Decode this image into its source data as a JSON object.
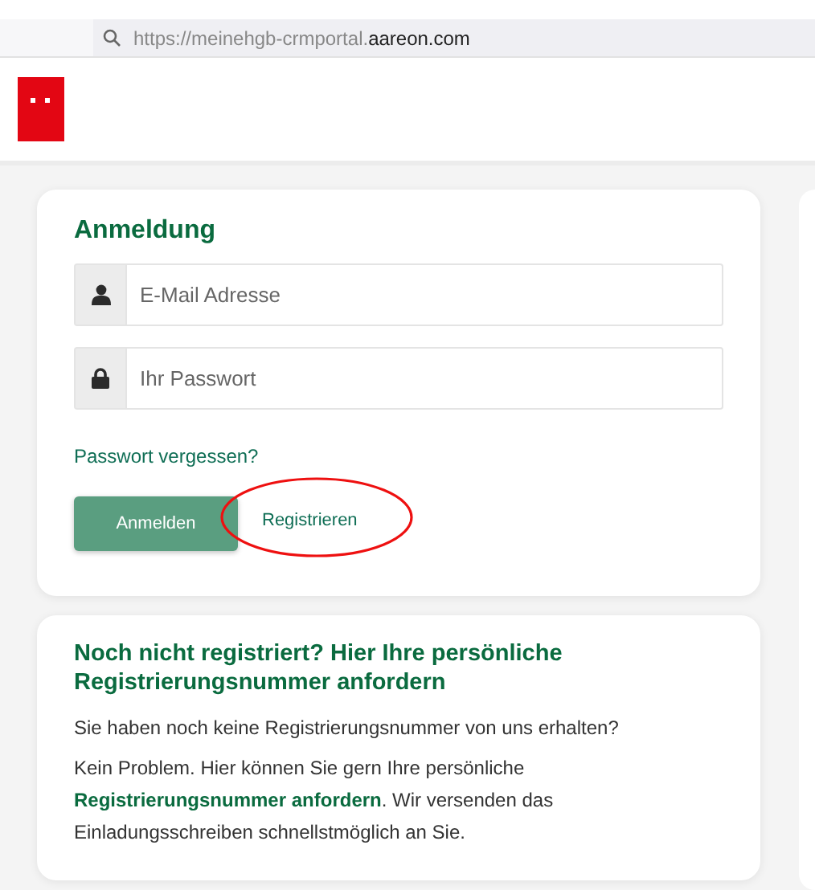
{
  "browser": {
    "url_prefix": "https://meinehgb-crmportal.",
    "url_domain": "aareon.com"
  },
  "login": {
    "title": "Anmeldung",
    "fields": [
      {
        "kind": "user",
        "placeholder": "E-Mail Adresse"
      },
      {
        "kind": "lock",
        "placeholder": "Ihr Passwort"
      }
    ],
    "forgot_link": "Passwort vergessen?",
    "submit_button": "Anmelden",
    "register_link": "Registrieren",
    "register_highlighted": true
  },
  "register_info": {
    "title": "Noch nicht registriert? Hier Ihre persönliche Registrierungsnummer anfordern",
    "paragraph_1": "Sie haben noch keine Registrierungsnummer von uns erhalten?",
    "paragraph_2_before": "Kein Problem. Hier können Sie gern Ihre persönliche",
    "paragraph_2_link": "Registrierungsnummer anfordern",
    "paragraph_2_after": ". Wir versenden das Einladungsschreiben schnellstmöglich an Sie."
  }
}
